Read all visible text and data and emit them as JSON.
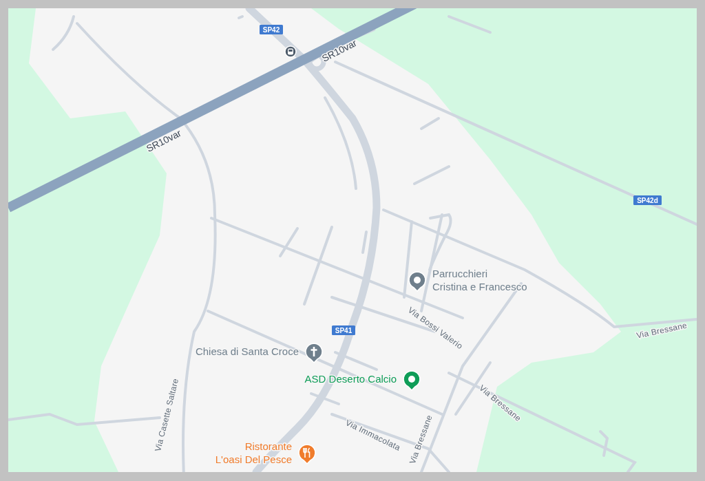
{
  "map": {
    "road_shields": [
      {
        "label": "SP42"
      },
      {
        "label": "SP42d"
      },
      {
        "label": "SP41"
      }
    ],
    "road_labels": [
      {
        "label": "SR10var"
      },
      {
        "label": "SR10var"
      },
      {
        "label": "Via Bressane"
      },
      {
        "label": "Via Bossi Valerio"
      },
      {
        "label": "Via Bressane"
      },
      {
        "label": "Via Immacolata"
      },
      {
        "label": "Via Bressane"
      },
      {
        "label": "Via Casette Saltare"
      }
    ],
    "places": [
      {
        "kind": "pin",
        "color": "#6f7f8c",
        "lines": [
          "Parrucchieri",
          "Cristina e Francesco"
        ]
      },
      {
        "kind": "church",
        "color": "#6f7f8c",
        "lines": [
          "Chiesa di Santa Croce"
        ]
      },
      {
        "kind": "pin",
        "color": "#0f9d58",
        "lines": [
          "ASD Deserto Calcio"
        ]
      },
      {
        "kind": "restaurant",
        "color": "#f07c2c",
        "lines": [
          "Ristorante",
          "L'oasi Del Pesce"
        ]
      }
    ],
    "transit_stops": [
      {
        "kind": "bus"
      }
    ]
  }
}
